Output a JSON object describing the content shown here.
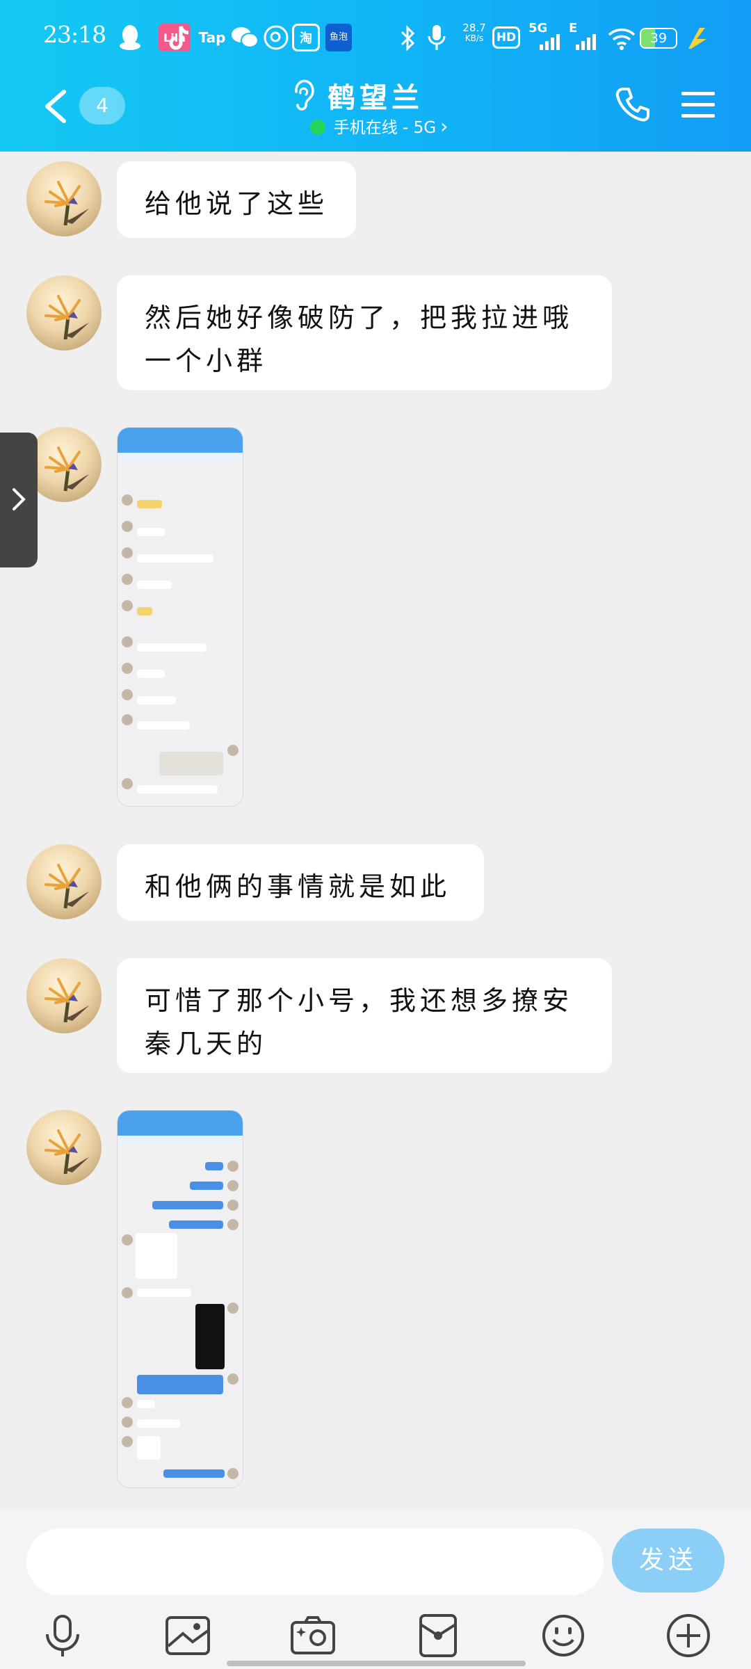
{
  "status_bar": {
    "time": "23:18",
    "app_badge_lila": "Lila",
    "app_badge_tap": "Tap",
    "app_badge_taobao": "淘",
    "app_badge_yuer": "鱼泡",
    "net_speed_value": "28.7",
    "net_speed_unit": "KB/s",
    "hd_label": "HD",
    "signal_1": "5G",
    "signal_2": "E",
    "battery_level": "39",
    "battery_fraction": 0.39
  },
  "header": {
    "unread_count": "4",
    "title": "鹤望兰",
    "subtitle": "手机在线 - 5G",
    "subtitle_chevron": "›"
  },
  "messages": [
    {
      "type": "text",
      "text": "给他说了这些"
    },
    {
      "type": "text",
      "text_line1": "然后她好像破防了，把我拉进哦",
      "text_line2": "一个小群"
    },
    {
      "type": "image"
    },
    {
      "type": "text",
      "text": "和他俩的事情就是如此"
    },
    {
      "type": "text",
      "text_line1": "可惜了那个小号，我还想多撩安",
      "text_line2": "秦几天的"
    },
    {
      "type": "image"
    }
  ],
  "input": {
    "value": "",
    "send_label": "发送"
  },
  "colors": {
    "header_start": "#15c8f3",
    "header_end": "#129df5",
    "send_button": "#8ccff6",
    "background": "#efefef",
    "online_dot": "#25d65a"
  },
  "icons": {
    "toolbar": [
      "microphone-icon",
      "image-icon",
      "camera-icon",
      "red-packet-icon",
      "emoji-icon",
      "plus-icon"
    ]
  }
}
